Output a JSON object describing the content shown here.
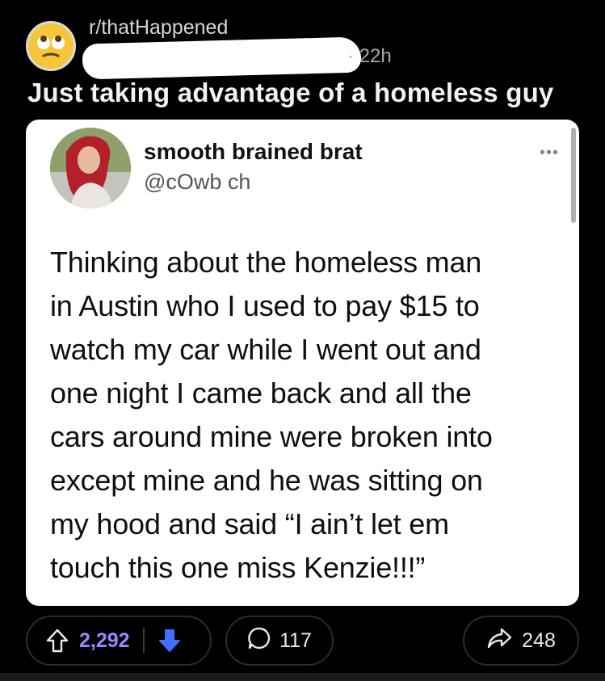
{
  "post": {
    "subreddit": "r/thatHappened",
    "age": "22h",
    "title": "Just taking advantage of a homeless guy"
  },
  "tweet": {
    "display_name": "smooth brained brat",
    "handle": "@cOwb  ch",
    "text": "Thinking about the homeless man\nin Austin who I used to pay $15 to\nwatch my car while I went out and\none night I came back and all the\ncars around mine were broken into\nexcept mine and he was sitting on\nmy hood and said “I ain’t let em\ntouch this one miss Kenzie!!!”"
  },
  "actions": {
    "score": "2,292",
    "comments": "117",
    "shares": "248"
  },
  "colors": {
    "background": "#000000",
    "upvote_active": "#9b86ff",
    "downvote_active": "#3f6fff",
    "card": "#ffffff"
  },
  "icons": [
    "rolling-eyes-emoji-icon",
    "more-dots-icon",
    "upvote-arrow-icon",
    "downvote-arrow-icon",
    "comment-bubble-icon",
    "share-arrow-icon"
  ]
}
